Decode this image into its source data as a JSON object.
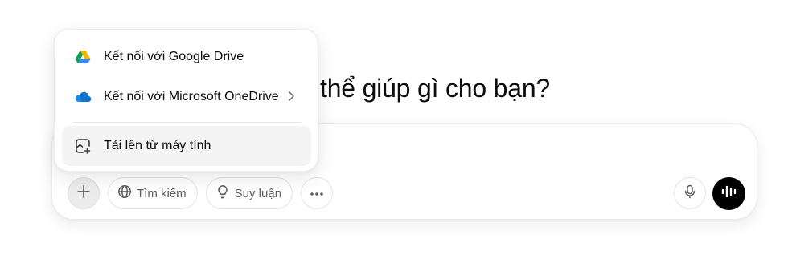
{
  "headline": "thể giúp gì cho bạn?",
  "menu": {
    "items": [
      {
        "label": "Kết nối với Google Drive",
        "icon": "google-drive-icon"
      },
      {
        "label": "Kết nối với Microsoft OneDrive",
        "icon": "onedrive-icon",
        "submenu": true
      },
      {
        "label": "Tải lên từ máy tính",
        "icon": "upload-image-icon",
        "highlighted": true
      }
    ]
  },
  "toolbar": {
    "add_icon": "plus-icon",
    "search_label": "Tìm kiếm",
    "reason_label": "Suy luận",
    "more_icon": "more-dots-icon",
    "mic_icon": "microphone-icon",
    "voice_icon": "voice-mode-icon"
  },
  "colors": {
    "drive_green": "#0F9D58",
    "drive_yellow": "#F4B400",
    "drive_blue": "#4285F4",
    "onedrive_blue": "#1E88E5",
    "voice_button": "#000000"
  }
}
